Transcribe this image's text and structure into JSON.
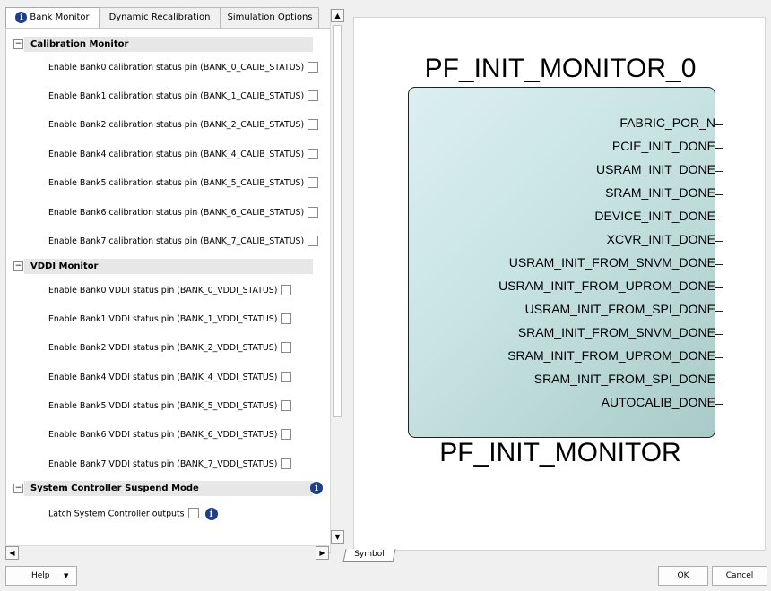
{
  "tabs": [
    {
      "label": "Bank Monitor"
    },
    {
      "label": "Dynamic Recalibration"
    },
    {
      "label": "Simulation Options"
    }
  ],
  "sections": {
    "calib": {
      "label": "Calibration Monitor",
      "items": [
        {
          "label": "Enable Bank0 calibration status pin (BANK_0_CALIB_STATUS)",
          "checked": false
        },
        {
          "label": "Enable Bank1 calibration status pin (BANK_1_CALIB_STATUS)",
          "checked": false
        },
        {
          "label": "Enable Bank2 calibration status pin (BANK_2_CALIB_STATUS)",
          "checked": false
        },
        {
          "label": "Enable Bank4 calibration status pin (BANK_4_CALIB_STATUS)",
          "checked": false
        },
        {
          "label": "Enable Bank5 calibration status pin (BANK_5_CALIB_STATUS)",
          "checked": false
        },
        {
          "label": "Enable Bank6 calibration status pin (BANK_6_CALIB_STATUS)",
          "checked": false
        },
        {
          "label": "Enable Bank7 calibration status pin (BANK_7_CALIB_STATUS)",
          "checked": false
        }
      ]
    },
    "vddi": {
      "label": "VDDI Monitor",
      "items": [
        {
          "label": "Enable Bank0 VDDI status pin (BANK_0_VDDI_STATUS)",
          "checked": false
        },
        {
          "label": "Enable Bank1 VDDI status pin (BANK_1_VDDI_STATUS)",
          "checked": false
        },
        {
          "label": "Enable Bank2 VDDI status pin (BANK_2_VDDI_STATUS)",
          "checked": false
        },
        {
          "label": "Enable Bank4 VDDI status pin (BANK_4_VDDI_STATUS)",
          "checked": false
        },
        {
          "label": "Enable Bank5 VDDI status pin (BANK_5_VDDI_STATUS)",
          "checked": false
        },
        {
          "label": "Enable Bank6 VDDI status pin (BANK_6_VDDI_STATUS)",
          "checked": false
        },
        {
          "label": "Enable Bank7 VDDI status pin (BANK_7_VDDI_STATUS)",
          "checked": false
        }
      ]
    },
    "syscon": {
      "label": "System Controller Suspend Mode",
      "items": [
        {
          "label": "Latch System Controller outputs",
          "checked": false
        }
      ]
    }
  },
  "symbol": {
    "instance_name": "PF_INIT_MONITOR_0",
    "component_name": "PF_INIT_MONITOR",
    "pins": [
      "FABRIC_POR_N",
      "PCIE_INIT_DONE",
      "USRAM_INIT_DONE",
      "SRAM_INIT_DONE",
      "DEVICE_INIT_DONE",
      "XCVR_INIT_DONE",
      "USRAM_INIT_FROM_SNVM_DONE",
      "USRAM_INIT_FROM_UPROM_DONE",
      "USRAM_INIT_FROM_SPI_DONE",
      "SRAM_INIT_FROM_SNVM_DONE",
      "SRAM_INIT_FROM_UPROM_DONE",
      "SRAM_INIT_FROM_SPI_DONE",
      "AUTOCALIB_DONE"
    ]
  },
  "symbol_tab": {
    "label": "Symbol"
  },
  "buttons": {
    "help": "Help",
    "ok": "OK",
    "cancel": "Cancel"
  },
  "icons": {
    "info": "info-icon",
    "expand": "collapse-minus-icon"
  },
  "colors": {
    "info_icon": "#1e3f8a",
    "symbol_fill": "#c7e3e2"
  }
}
